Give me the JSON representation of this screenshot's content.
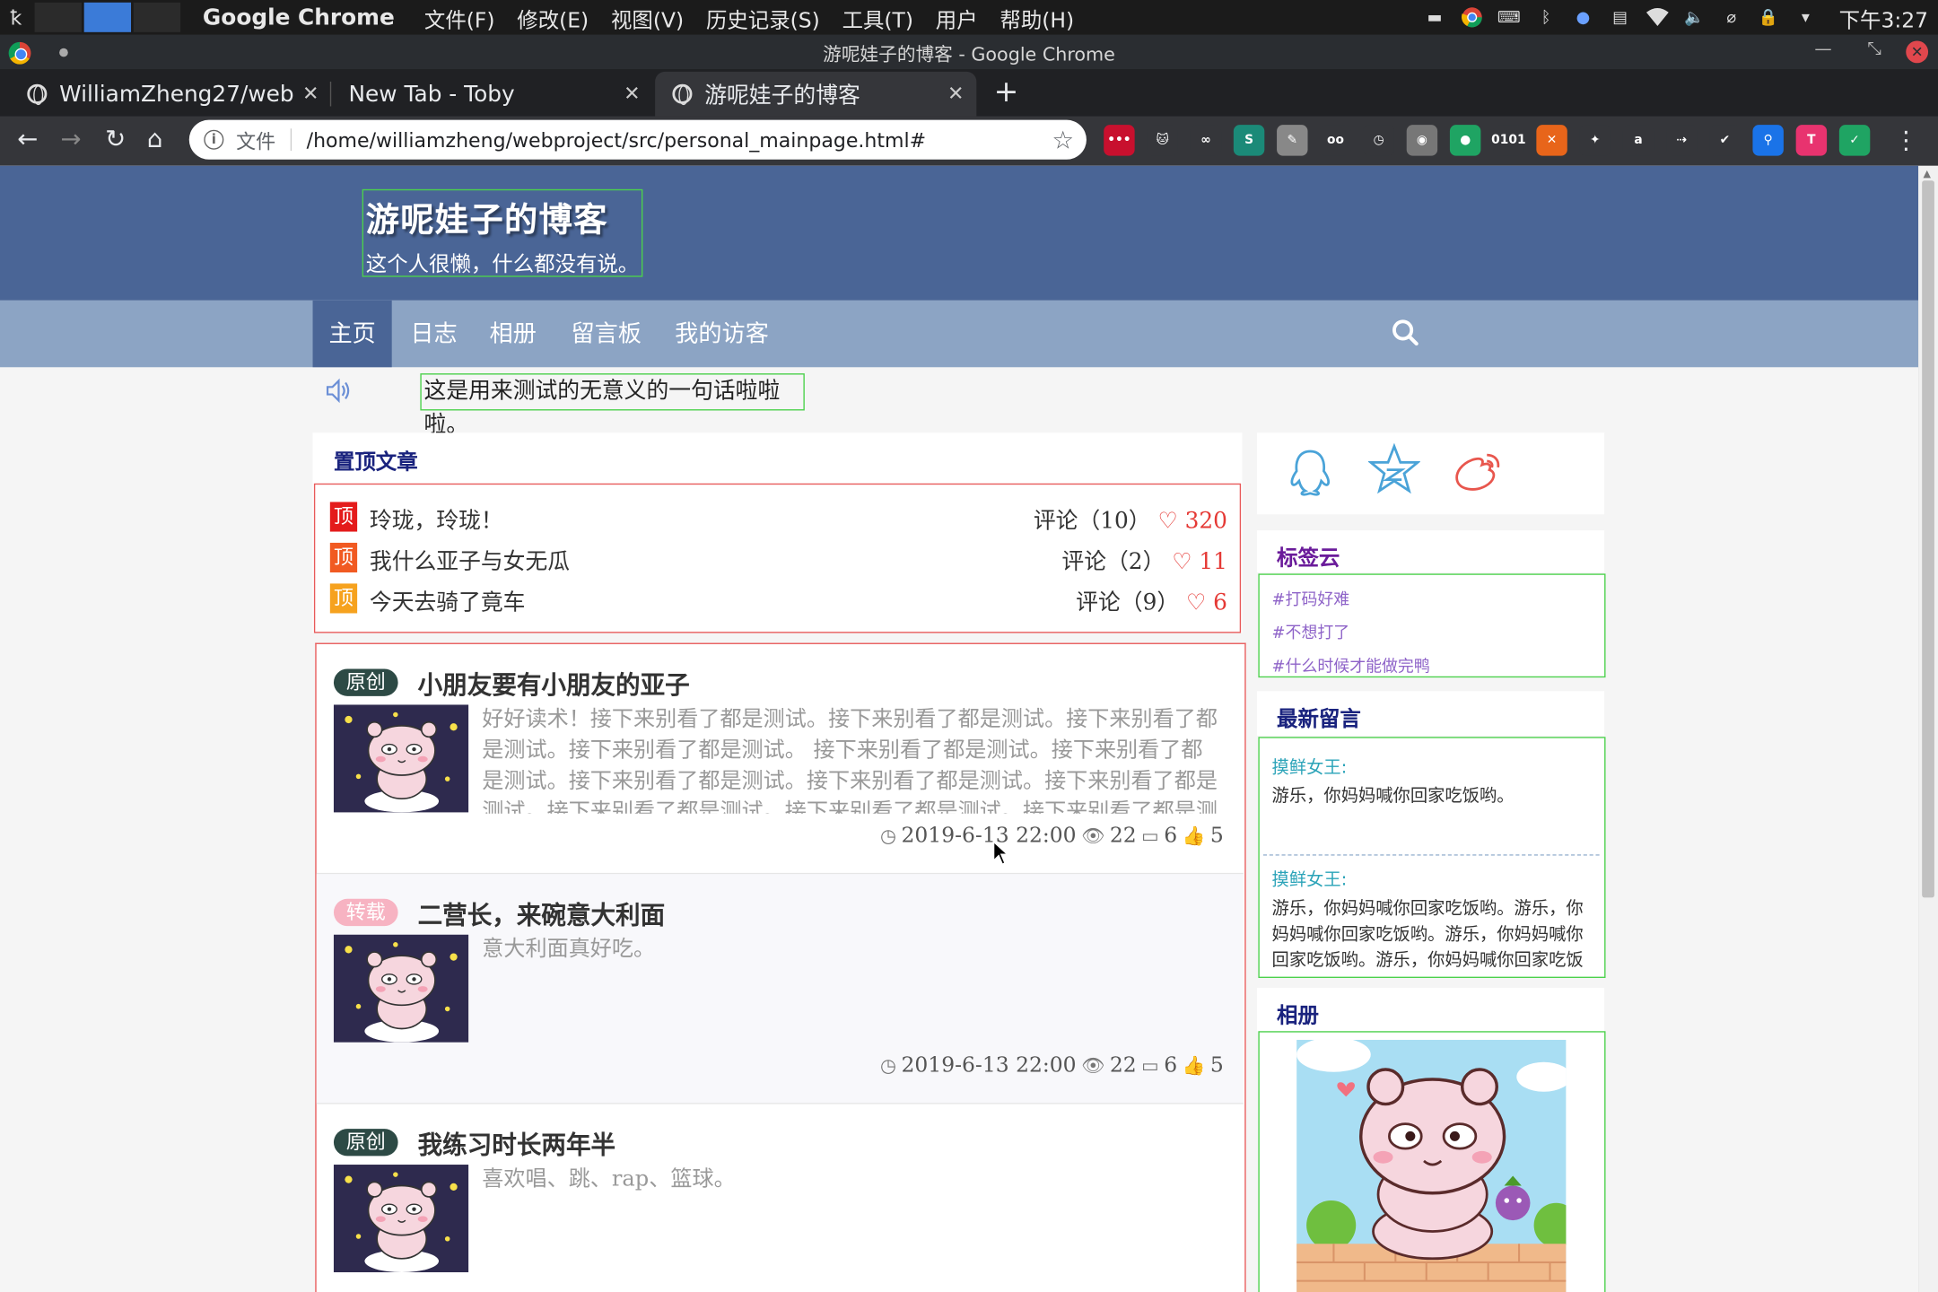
{
  "system": {
    "app_name": "Google Chrome",
    "menu": [
      "文件(F)",
      "修改(E)",
      "视图(V)",
      "历史记录(S)",
      "工具(T)",
      "用户",
      "帮助(H)"
    ],
    "clock": "下午3:27"
  },
  "window": {
    "title": "游呢娃子的博客 - Google Chrome"
  },
  "tabs": [
    {
      "label": "WilliamZheng27/webp",
      "active": false
    },
    {
      "label": "New Tab - Toby",
      "active": false
    },
    {
      "label": "游呢娃子的博客",
      "active": true
    }
  ],
  "omnibox": {
    "scheme_label": "文件",
    "url": "/home/williamzheng/webproject/src/personal_mainpage.html#"
  },
  "extensions": [
    {
      "name": "lastpass-icon",
      "color": "#c8102e",
      "glyph": "•••"
    },
    {
      "name": "cat-icon",
      "color": "#35363a",
      "glyph": "🐱"
    },
    {
      "name": "infinity-icon",
      "color": "#35363a",
      "glyph": "∞"
    },
    {
      "name": "s-icon",
      "color": "#1b8a78",
      "glyph": "S"
    },
    {
      "name": "feather-icon",
      "color": "#888",
      "glyph": "✎"
    },
    {
      "name": "glasses-icon",
      "color": "#35363a",
      "glyph": "oo"
    },
    {
      "name": "clock-icon",
      "color": "#35363a",
      "glyph": "◷"
    },
    {
      "name": "camera-icon",
      "color": "#777",
      "glyph": "◉"
    },
    {
      "name": "chat-icon",
      "color": "#1fa463",
      "glyph": "●"
    },
    {
      "name": "binary-icon",
      "color": "#35363a",
      "glyph": "0101"
    },
    {
      "name": "orange-icon",
      "color": "#e8651a",
      "glyph": "✕"
    },
    {
      "name": "bug-icon",
      "color": "#35363a",
      "glyph": "✦"
    },
    {
      "name": "amazon-icon",
      "color": "#35363a",
      "glyph": "a"
    },
    {
      "name": "dash-icon",
      "color": "#35363a",
      "glyph": "⇢"
    },
    {
      "name": "check-circle-icon",
      "color": "#35363a",
      "glyph": "✔"
    },
    {
      "name": "pin-icon",
      "color": "#1a73e8",
      "glyph": "⚲"
    },
    {
      "name": "t-icon",
      "color": "#e8336f",
      "glyph": "T"
    },
    {
      "name": "profile-check-icon",
      "color": "#1fa463",
      "glyph": "✓"
    }
  ],
  "blog": {
    "title": "游呢娃子的博客",
    "subtitle": "这个人很懒，什么都没有说。",
    "nav": [
      "主页",
      "日志",
      "相册",
      "留言板",
      "我的访客"
    ],
    "notice": "这是用来测试的无意义的一句话啦啦啦。",
    "pinned": {
      "heading": "置顶文章",
      "badge_label": "顶",
      "items": [
        {
          "title": "玲珑，玲珑！",
          "comments": "评论（10）",
          "likes": "320",
          "badge_color": "#e41b1b"
        },
        {
          "title": "我什么亚子与女无瓜",
          "comments": "评论（2）",
          "likes": "11",
          "badge_color": "#f15a22"
        },
        {
          "title": "今天去骑了竟车",
          "comments": "评论（9）",
          "likes": "6",
          "badge_color": "#f6a21e"
        }
      ]
    },
    "posts": [
      {
        "tag": "原创",
        "tag_color": "#2d4a45",
        "title": "小朋友要有小朋友的亚子",
        "excerpt": "好好读术！接下来别看了都是测试。接下来别看了都是测试。接下来别看了都是测试。接下来别看了都是测试。 接下来别看了都是测试。接下来别看了都是测试。接下来别看了都是测试。接下来别看了都是测试。接下来别看了都是测试。接下来别看了都是测试。接下来别看了都是测试。接下来别看了都是测试。接下来别看了都是测试。",
        "date": "2019-6-13 22:00",
        "views": "22",
        "comments": "6",
        "likes": "5"
      },
      {
        "tag": "转载",
        "tag_color": "#f7b3c2",
        "title": "二营长，来碗意大利面",
        "excerpt": "意大利面真好吃。",
        "date": "2019-6-13 22:00",
        "views": "22",
        "comments": "6",
        "likes": "5"
      },
      {
        "tag": "原创",
        "tag_color": "#2d4a45",
        "title": "我练习时长两年半",
        "excerpt": "喜欢唱、跳、rap、篮球。",
        "date": "",
        "views": "",
        "comments": "",
        "likes": ""
      }
    ],
    "sidebar": {
      "social": [
        "qq-icon",
        "star-icon",
        "weibo-icon"
      ],
      "tagcloud": {
        "heading": "标签云",
        "tags": [
          "#打码好难",
          "#不想打了",
          "#什么时候才能做完鸭"
        ]
      },
      "messages": {
        "heading": "最新留言",
        "items": [
          {
            "author": "摸鲜女王:",
            "text": "游乐，你妈妈喊你回家吃饭哟。"
          },
          {
            "author": "摸鲜女王:",
            "text": "游乐，你妈妈喊你回家吃饭哟。游乐，你妈妈喊你回家吃饭哟。游乐，你妈妈喊你回家吃饭哟。游乐，你妈妈喊你回家吃饭哟。"
          }
        ]
      },
      "album": {
        "heading": "相册"
      }
    }
  }
}
